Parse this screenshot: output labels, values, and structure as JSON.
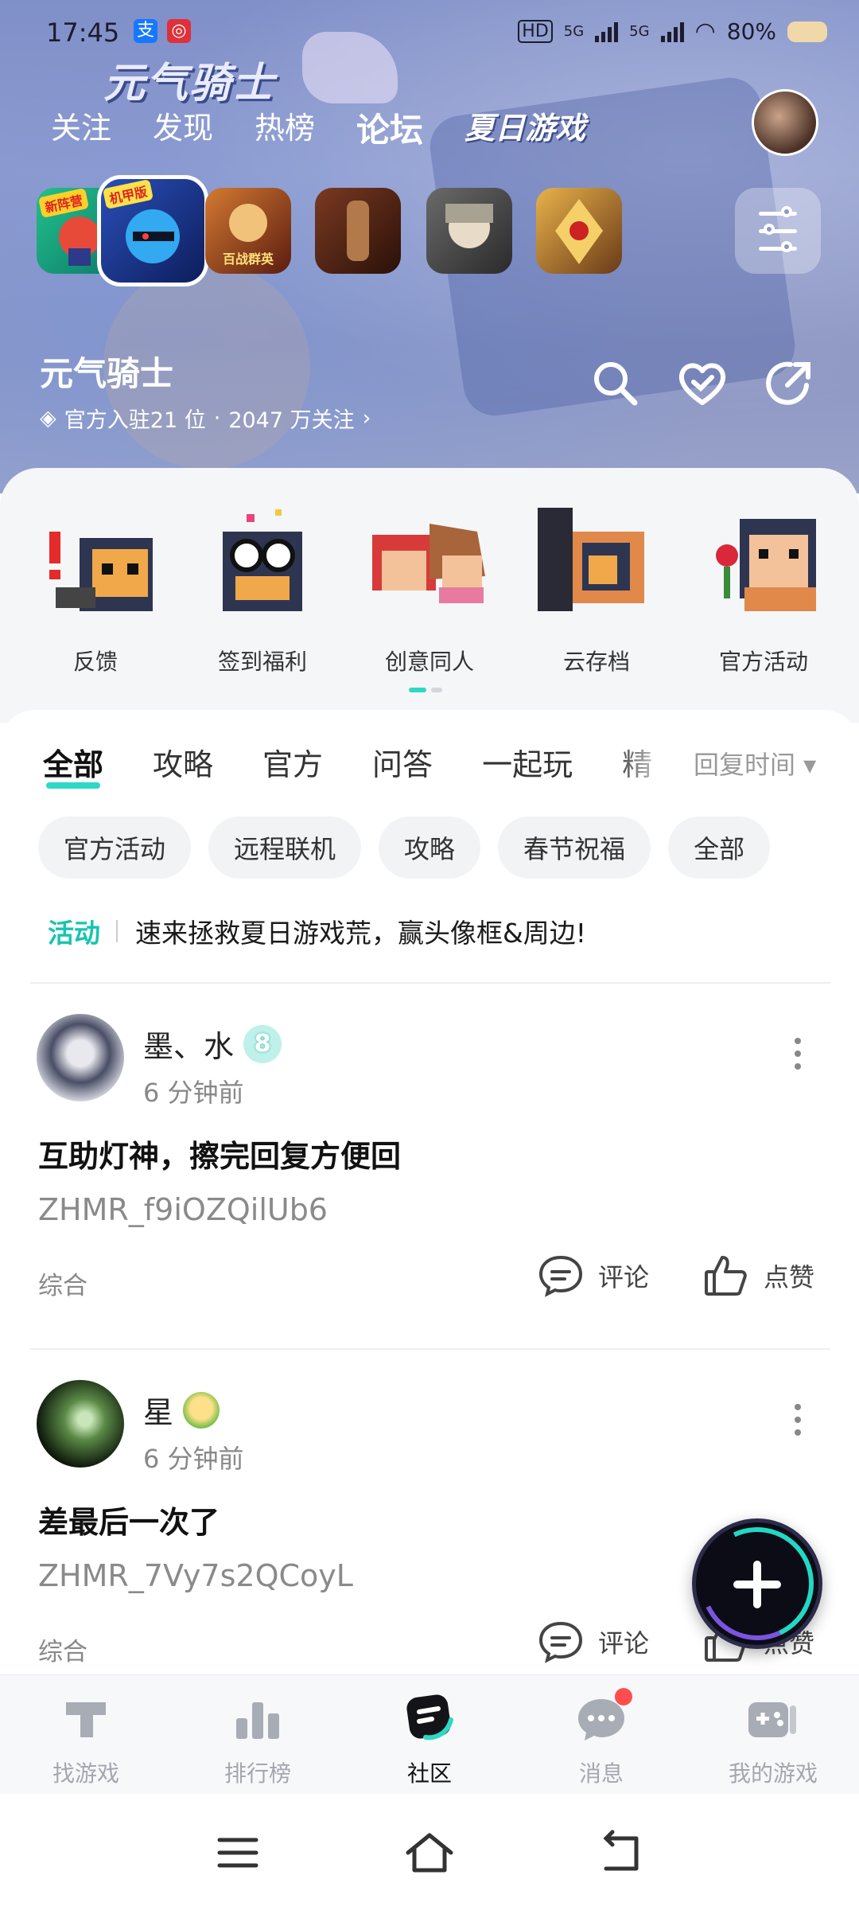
{
  "status": {
    "time": "17:45",
    "network_label": "HD",
    "net1": "5G",
    "net2": "5G",
    "battery": "80%"
  },
  "game_logo": "元气骑士",
  "top_tabs": [
    "关注",
    "发现",
    "热榜",
    "论坛",
    "夏日游戏"
  ],
  "active_top_tab": "论坛",
  "game_icons": [
    {
      "badge": "新阵营",
      "label": ""
    },
    {
      "badge": "机甲版",
      "label": ""
    },
    {
      "badge": "",
      "label": "百战群英"
    },
    {
      "badge": "",
      "label": ""
    },
    {
      "badge": "",
      "label": ""
    },
    {
      "badge": "",
      "label": ""
    }
  ],
  "game": {
    "name": "元气骑士",
    "meta_rank": "官方入驻21 位",
    "meta_dot": "·",
    "meta_followers": "2047 万关注"
  },
  "quick_menu": [
    "反馈",
    "签到福利",
    "创意同人",
    "云存档",
    "官方活动"
  ],
  "category_tabs": [
    "全部",
    "攻略",
    "官方",
    "问答",
    "一起玩",
    "精"
  ],
  "sort_label": "回复时间 ▾",
  "chips": [
    "官方活动",
    "远程联机",
    "攻略",
    "春节祝福",
    "全部"
  ],
  "announcement": {
    "tag": "活动",
    "text": "速来拯救夏日游戏荒，赢头像框&周边!"
  },
  "posts": [
    {
      "author": "墨、水",
      "level": "8",
      "time": "6 分钟前",
      "title": "互助灯神，擦完回复方便回",
      "code": "ZHMR_f9iOZQilUb6",
      "category": "综合",
      "comment_label": "评论",
      "like_label": "点赞"
    },
    {
      "author": "星",
      "level": "",
      "time": "6 分钟前",
      "title": "差最后一次了",
      "code": "ZHMR_7Vy7s2QCoyL",
      "category": "综合",
      "comment_label": "评论",
      "like_label": "点赞"
    }
  ],
  "bottom_nav": [
    "找游戏",
    "排行榜",
    "社区",
    "消息",
    "我的游戏"
  ],
  "active_nav": "社区",
  "colors": {
    "accent": "#2dd9c4",
    "announce_tag": "#17c4b0",
    "notify_dot": "#ff4d4f"
  }
}
